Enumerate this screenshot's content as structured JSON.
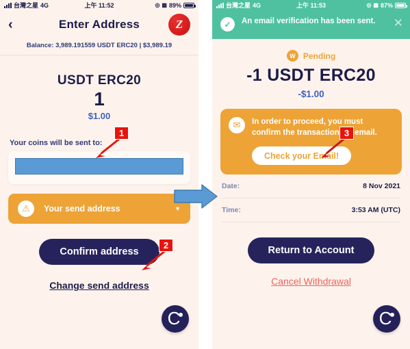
{
  "left_phone": {
    "statusbar": {
      "carrier": "台灣之星",
      "network": "4G",
      "time": "上午 11:52",
      "battery_percent": "89%",
      "signal_icon": "signal-bars-icon",
      "location_icon": "location-arrow-icon",
      "alarm_icon": "alarm-icon",
      "battery_icon": "battery-icon"
    },
    "nav": {
      "back_icon": "back-chevron-icon",
      "title": "Enter Address",
      "logo_text": "Z",
      "logo_icon": "brand-logo-icon"
    },
    "balance": "Balance: 3,989.191559 USDT ERC20  |  $3,989.19",
    "amount": {
      "coin": "USDT ERC20",
      "quantity": "1",
      "fiat": "$1.00"
    },
    "sent_to_label": "Your coins will be sent to:",
    "address_value": "",
    "address_redacted": true,
    "send_address_select": {
      "label": "Your send address",
      "warning_icon": "warning-triangle-icon",
      "caret_icon": "chevron-down-icon"
    },
    "confirm_button": "Confirm address",
    "change_link": "Change send address",
    "badge_icon": "celsius-logo-icon",
    "badge_letter": "C"
  },
  "right_phone": {
    "statusbar": {
      "carrier": "台灣之星",
      "network": "4G",
      "time": "上午 11:53",
      "battery_percent": "87%",
      "signal_icon": "signal-bars-icon",
      "location_icon": "location-arrow-icon",
      "alarm_icon": "alarm-icon",
      "battery_icon": "battery-icon"
    },
    "toast": {
      "message": "An email verification has been sent.",
      "check_icon": "check-circle-icon",
      "close_icon": "close-icon"
    },
    "status": {
      "icon_letter": "W",
      "icon_name": "pending-withdrawal-icon",
      "label": "Pending"
    },
    "amount": {
      "coin": "-1 USDT ERC20",
      "fiat": "-$1.00"
    },
    "notice": {
      "icon": "envelope-icon",
      "text": "In order to proceed, you must confirm the transaction via email.",
      "button": "Check your Email!"
    },
    "details": [
      {
        "key": "Date:",
        "value": "8 Nov 2021"
      },
      {
        "key": "Time:",
        "value": "3:53 AM (UTC)"
      }
    ],
    "return_button": "Return to Account",
    "cancel_link": "Cancel Withdrawal",
    "badge_icon": "celsius-logo-icon",
    "badge_letter": "C"
  },
  "annotations": {
    "step1": "1",
    "step2": "2",
    "step3": "3",
    "flow_arrow_icon": "flow-arrow-right-icon"
  },
  "colors": {
    "cream_bg": "#fdf3ec",
    "navy": "#1c1c4a",
    "navy_button": "#26235c",
    "orange": "#eda336",
    "green_toast": "#4fc1a0",
    "blue_link": "#3f5fc0",
    "red_cancel": "#f0615f",
    "annotation_red": "#e8140c",
    "redaction_blue": "#5b9bd5",
    "flow_arrow_blue": "#5b9bd5"
  }
}
